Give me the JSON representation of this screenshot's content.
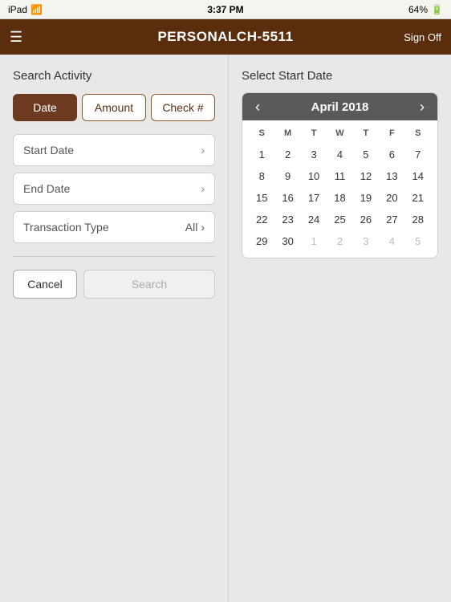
{
  "statusBar": {
    "left": "iPad",
    "time": "3:37 PM",
    "battery": "64%"
  },
  "header": {
    "title": "PERSONALCH-5511",
    "signOff": "Sign Off"
  },
  "leftPanel": {
    "title": "Search Activity",
    "tabs": [
      {
        "label": "Date",
        "active": true
      },
      {
        "label": "Amount",
        "active": false
      },
      {
        "label": "Check #",
        "active": false
      }
    ],
    "startDateLabel": "Start Date",
    "endDateLabel": "End Date",
    "transactionTypeLabel": "Transaction Type",
    "transactionTypeValue": "All",
    "cancelLabel": "Cancel",
    "searchLabel": "Search"
  },
  "rightPanel": {
    "title": "Select Start Date",
    "calendar": {
      "monthYear": "April 2018",
      "dayHeaders": [
        "S",
        "M",
        "T",
        "W",
        "T",
        "F",
        "S"
      ],
      "weeks": [
        [
          {
            "day": "1",
            "otherMonth": false
          },
          {
            "day": "2",
            "otherMonth": false
          },
          {
            "day": "3",
            "otherMonth": false
          },
          {
            "day": "4",
            "otherMonth": false
          },
          {
            "day": "5",
            "otherMonth": false
          },
          {
            "day": "6",
            "otherMonth": false
          },
          {
            "day": "7",
            "otherMonth": false
          }
        ],
        [
          {
            "day": "8",
            "otherMonth": false
          },
          {
            "day": "9",
            "otherMonth": false
          },
          {
            "day": "10",
            "otherMonth": false
          },
          {
            "day": "11",
            "otherMonth": false
          },
          {
            "day": "12",
            "otherMonth": false
          },
          {
            "day": "13",
            "otherMonth": false
          },
          {
            "day": "14",
            "otherMonth": false
          }
        ],
        [
          {
            "day": "15",
            "otherMonth": false
          },
          {
            "day": "16",
            "otherMonth": false
          },
          {
            "day": "17",
            "otherMonth": false
          },
          {
            "day": "18",
            "otherMonth": false
          },
          {
            "day": "19",
            "otherMonth": false
          },
          {
            "day": "20",
            "otherMonth": false
          },
          {
            "day": "21",
            "otherMonth": false
          }
        ],
        [
          {
            "day": "22",
            "otherMonth": false
          },
          {
            "day": "23",
            "otherMonth": false
          },
          {
            "day": "24",
            "otherMonth": false
          },
          {
            "day": "25",
            "otherMonth": false
          },
          {
            "day": "26",
            "otherMonth": false
          },
          {
            "day": "27",
            "otherMonth": false
          },
          {
            "day": "28",
            "otherMonth": false
          }
        ],
        [
          {
            "day": "29",
            "otherMonth": false
          },
          {
            "day": "30",
            "otherMonth": false
          },
          {
            "day": "1",
            "otherMonth": true
          },
          {
            "day": "2",
            "otherMonth": true
          },
          {
            "day": "3",
            "otherMonth": true
          },
          {
            "day": "4",
            "otherMonth": true
          },
          {
            "day": "5",
            "otherMonth": true
          }
        ]
      ]
    }
  }
}
